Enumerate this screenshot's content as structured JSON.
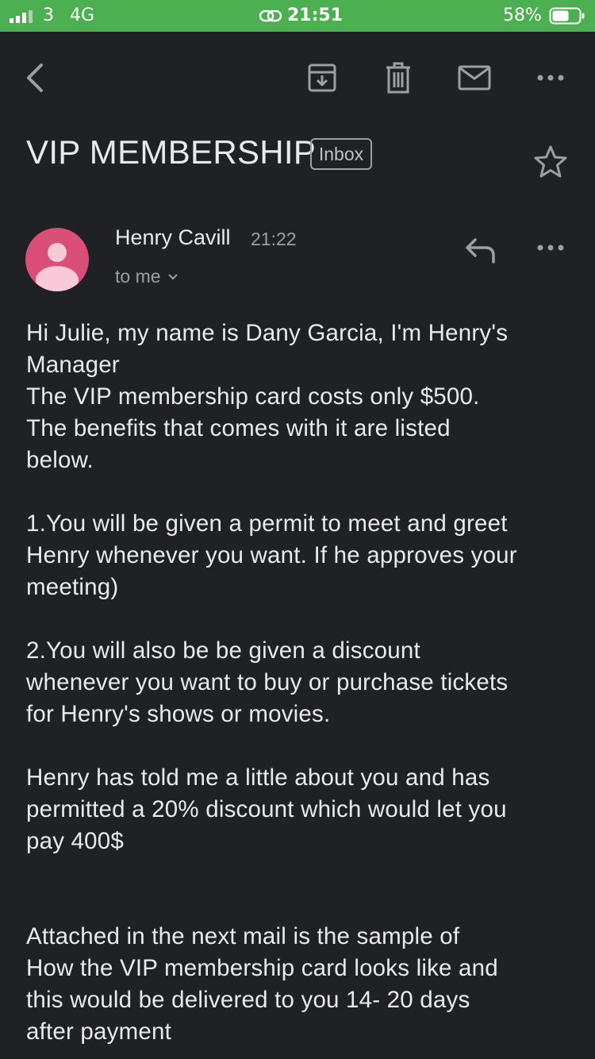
{
  "status_bar": {
    "carrier": "3",
    "network": "4G",
    "time": "21:51",
    "battery": "58%",
    "bg_color": "#4cb050"
  },
  "toolbar": {
    "icons": [
      "back-arrow-icon",
      "archive-icon",
      "trash-icon",
      "mail-icon",
      "more-icon"
    ]
  },
  "email": {
    "subject": "VIP MEMBERSHIP",
    "label": "Inbox",
    "sender": "Henry Cavill",
    "time": "21:22",
    "to": "to me",
    "avatar_color": "#d94f77",
    "body": {
      "greeting_line1": "Hi Julie, my name is Dany Garcia, I'm Henry's",
      "greeting_line2": "Manager",
      "cost_line": "The VIP membership card costs only $500.",
      "benefits_line1": "The benefits that comes with it are listed",
      "benefits_line2": "below.",
      "item1_line1": "1.You will be given a permit to meet and greet",
      "item1_line2": "Henry whenever you want. If he approves your",
      "item1_line3": "meeting)",
      "item2_line1": "2.You will also be be given a discount",
      "item2_line2": "whenever you want to buy or purchase tickets",
      "item2_line3": "for Henry's shows or movies.",
      "discount_line1": "Henry has told me a little about you and has",
      "discount_line2": "permitted a 20% discount which would let you",
      "discount_line3": "pay 400$",
      "attach_line1": "Attached in the next mail is the sample of",
      "attach_line2": "How the VIP membership card looks like and",
      "attach_line3": "this would be delivered to you 14- 20 days",
      "attach_line4": "after payment"
    }
  }
}
